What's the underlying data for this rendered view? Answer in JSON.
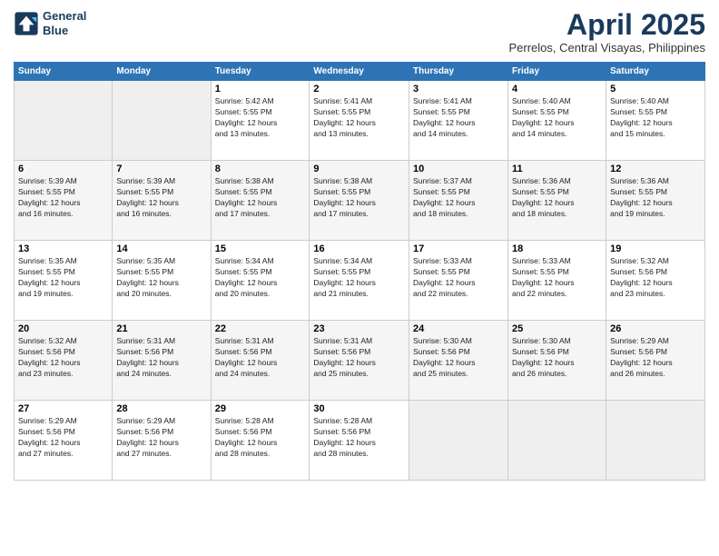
{
  "header": {
    "logo_line1": "General",
    "logo_line2": "Blue",
    "title": "April 2025",
    "location": "Perrelos, Central Visayas, Philippines"
  },
  "columns": [
    "Sunday",
    "Monday",
    "Tuesday",
    "Wednesday",
    "Thursday",
    "Friday",
    "Saturday"
  ],
  "weeks": [
    [
      {
        "day": "",
        "info": ""
      },
      {
        "day": "",
        "info": ""
      },
      {
        "day": "1",
        "info": "Sunrise: 5:42 AM\nSunset: 5:55 PM\nDaylight: 12 hours\nand 13 minutes."
      },
      {
        "day": "2",
        "info": "Sunrise: 5:41 AM\nSunset: 5:55 PM\nDaylight: 12 hours\nand 13 minutes."
      },
      {
        "day": "3",
        "info": "Sunrise: 5:41 AM\nSunset: 5:55 PM\nDaylight: 12 hours\nand 14 minutes."
      },
      {
        "day": "4",
        "info": "Sunrise: 5:40 AM\nSunset: 5:55 PM\nDaylight: 12 hours\nand 14 minutes."
      },
      {
        "day": "5",
        "info": "Sunrise: 5:40 AM\nSunset: 5:55 PM\nDaylight: 12 hours\nand 15 minutes."
      }
    ],
    [
      {
        "day": "6",
        "info": "Sunrise: 5:39 AM\nSunset: 5:55 PM\nDaylight: 12 hours\nand 16 minutes."
      },
      {
        "day": "7",
        "info": "Sunrise: 5:39 AM\nSunset: 5:55 PM\nDaylight: 12 hours\nand 16 minutes."
      },
      {
        "day": "8",
        "info": "Sunrise: 5:38 AM\nSunset: 5:55 PM\nDaylight: 12 hours\nand 17 minutes."
      },
      {
        "day": "9",
        "info": "Sunrise: 5:38 AM\nSunset: 5:55 PM\nDaylight: 12 hours\nand 17 minutes."
      },
      {
        "day": "10",
        "info": "Sunrise: 5:37 AM\nSunset: 5:55 PM\nDaylight: 12 hours\nand 18 minutes."
      },
      {
        "day": "11",
        "info": "Sunrise: 5:36 AM\nSunset: 5:55 PM\nDaylight: 12 hours\nand 18 minutes."
      },
      {
        "day": "12",
        "info": "Sunrise: 5:36 AM\nSunset: 5:55 PM\nDaylight: 12 hours\nand 19 minutes."
      }
    ],
    [
      {
        "day": "13",
        "info": "Sunrise: 5:35 AM\nSunset: 5:55 PM\nDaylight: 12 hours\nand 19 minutes."
      },
      {
        "day": "14",
        "info": "Sunrise: 5:35 AM\nSunset: 5:55 PM\nDaylight: 12 hours\nand 20 minutes."
      },
      {
        "day": "15",
        "info": "Sunrise: 5:34 AM\nSunset: 5:55 PM\nDaylight: 12 hours\nand 20 minutes."
      },
      {
        "day": "16",
        "info": "Sunrise: 5:34 AM\nSunset: 5:55 PM\nDaylight: 12 hours\nand 21 minutes."
      },
      {
        "day": "17",
        "info": "Sunrise: 5:33 AM\nSunset: 5:55 PM\nDaylight: 12 hours\nand 22 minutes."
      },
      {
        "day": "18",
        "info": "Sunrise: 5:33 AM\nSunset: 5:55 PM\nDaylight: 12 hours\nand 22 minutes."
      },
      {
        "day": "19",
        "info": "Sunrise: 5:32 AM\nSunset: 5:56 PM\nDaylight: 12 hours\nand 23 minutes."
      }
    ],
    [
      {
        "day": "20",
        "info": "Sunrise: 5:32 AM\nSunset: 5:56 PM\nDaylight: 12 hours\nand 23 minutes."
      },
      {
        "day": "21",
        "info": "Sunrise: 5:31 AM\nSunset: 5:56 PM\nDaylight: 12 hours\nand 24 minutes."
      },
      {
        "day": "22",
        "info": "Sunrise: 5:31 AM\nSunset: 5:56 PM\nDaylight: 12 hours\nand 24 minutes."
      },
      {
        "day": "23",
        "info": "Sunrise: 5:31 AM\nSunset: 5:56 PM\nDaylight: 12 hours\nand 25 minutes."
      },
      {
        "day": "24",
        "info": "Sunrise: 5:30 AM\nSunset: 5:56 PM\nDaylight: 12 hours\nand 25 minutes."
      },
      {
        "day": "25",
        "info": "Sunrise: 5:30 AM\nSunset: 5:56 PM\nDaylight: 12 hours\nand 26 minutes."
      },
      {
        "day": "26",
        "info": "Sunrise: 5:29 AM\nSunset: 5:56 PM\nDaylight: 12 hours\nand 26 minutes."
      }
    ],
    [
      {
        "day": "27",
        "info": "Sunrise: 5:29 AM\nSunset: 5:56 PM\nDaylight: 12 hours\nand 27 minutes."
      },
      {
        "day": "28",
        "info": "Sunrise: 5:29 AM\nSunset: 5:56 PM\nDaylight: 12 hours\nand 27 minutes."
      },
      {
        "day": "29",
        "info": "Sunrise: 5:28 AM\nSunset: 5:56 PM\nDaylight: 12 hours\nand 28 minutes."
      },
      {
        "day": "30",
        "info": "Sunrise: 5:28 AM\nSunset: 5:56 PM\nDaylight: 12 hours\nand 28 minutes."
      },
      {
        "day": "",
        "info": ""
      },
      {
        "day": "",
        "info": ""
      },
      {
        "day": "",
        "info": ""
      }
    ]
  ]
}
